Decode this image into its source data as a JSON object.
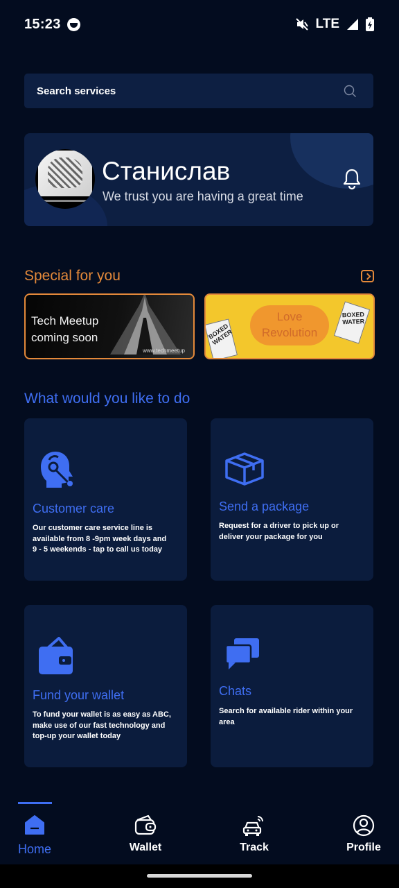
{
  "status_bar": {
    "time": "15:23",
    "network": "LTE",
    "icons": [
      "app-notification-icon",
      "mute-icon",
      "signal-icon",
      "battery-charging-icon"
    ]
  },
  "search": {
    "placeholder": "Search services",
    "icon": "search-icon"
  },
  "greeting": {
    "name": "Станислав",
    "subtitle": "We trust you are having a great time",
    "icon": "bell-icon"
  },
  "special": {
    "title": "Special for you",
    "banners": [
      {
        "line1": "Tech Meetup",
        "line2": "coming soon",
        "url": "www.techmeetup"
      },
      {
        "line1": "Love",
        "line2": "Revolution",
        "carton_text": "BOXED WATER"
      }
    ]
  },
  "actions": {
    "title": "What would you like to do",
    "tiles": [
      {
        "title": "Customer care",
        "description": "Our customer care service line is available from 8 -9pm week days and 9 - 5 weekends - tap to call us today",
        "icon": "customer-care-icon"
      },
      {
        "title": "Send a package",
        "description": "Request for a driver to pick up or deliver your package for you",
        "icon": "package-icon"
      },
      {
        "title": "Fund your wallet",
        "description": "To fund your wallet is as easy as ABC, make use of our fast technology and top-up your wallet today",
        "icon": "wallet-icon"
      },
      {
        "title": "Chats",
        "description": "Search for available rider within your area",
        "icon": "chats-icon"
      }
    ]
  },
  "bottom_nav": {
    "items": [
      {
        "label": "Home",
        "icon": "home-icon",
        "active": true
      },
      {
        "label": "Wallet",
        "icon": "wallet-icon",
        "active": false
      },
      {
        "label": "Track",
        "icon": "track-car-icon",
        "active": false
      },
      {
        "label": "Profile",
        "icon": "profile-icon",
        "active": false
      }
    ]
  },
  "colors": {
    "background": "#030c1f",
    "card": "#0b1c3d",
    "accent_blue": "#3f6ef2",
    "accent_orange": "#e4893a"
  }
}
